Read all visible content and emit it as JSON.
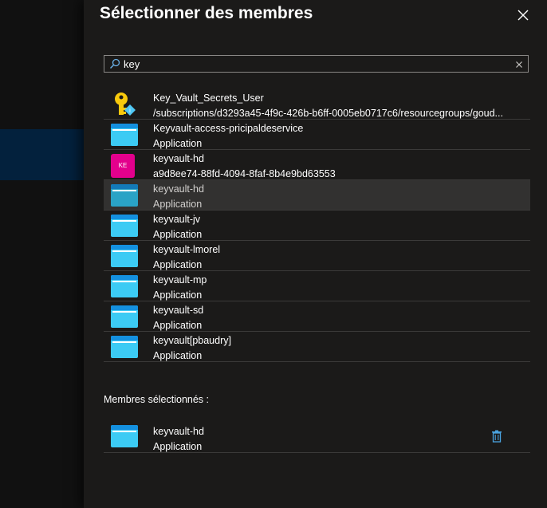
{
  "panel": {
    "title": "Sélectionner des membres",
    "close_icon": "close-icon"
  },
  "search": {
    "value": "key",
    "search_icon": "search-icon",
    "clear_icon": "clear-icon"
  },
  "results": [
    {
      "icon": "key-role-icon",
      "name": "Key_Vault_Secrets_User",
      "detail": "/subscriptions/d3293a45-4f9c-426b-b6ff-0005eb0717c6/resourcegroups/goud..."
    },
    {
      "icon": "application-icon",
      "name": "Keyvault-access-pricipaldeservice",
      "detail": "Application"
    },
    {
      "icon": "user-avatar",
      "avatar_text": "KE",
      "name": "keyvault-hd",
      "detail": "a9d8ee74-88fd-4094-8faf-8b4e9bd63553"
    },
    {
      "icon": "application-icon",
      "name": "keyvault-hd",
      "detail": "Application",
      "highlighted": true
    },
    {
      "icon": "application-icon",
      "name": "keyvault-jv",
      "detail": "Application"
    },
    {
      "icon": "application-icon",
      "name": "keyvault-lmorel",
      "detail": "Application"
    },
    {
      "icon": "application-icon",
      "name": "keyvault-mp",
      "detail": "Application"
    },
    {
      "icon": "application-icon",
      "name": "keyvault-sd",
      "detail": "Application"
    },
    {
      "icon": "application-icon",
      "name": "keyvault[pbaudry]",
      "detail": "Application"
    }
  ],
  "selected": {
    "label": "Membres sélectionnés :",
    "items": [
      {
        "icon": "application-icon",
        "name": "keyvault-hd",
        "detail": "Application",
        "remove_icon": "trash-icon"
      }
    ]
  },
  "colors": {
    "panel_bg": "#1b1a19",
    "left_strip_bg": "#111111",
    "left_selected_bg": "#03213d",
    "highlight_row_bg": "#323130",
    "app_icon": "#3ccbf4",
    "avatar_bg": "#e3008c",
    "key_icon": "#f8c90c",
    "trash_icon": "#4aa3df"
  }
}
